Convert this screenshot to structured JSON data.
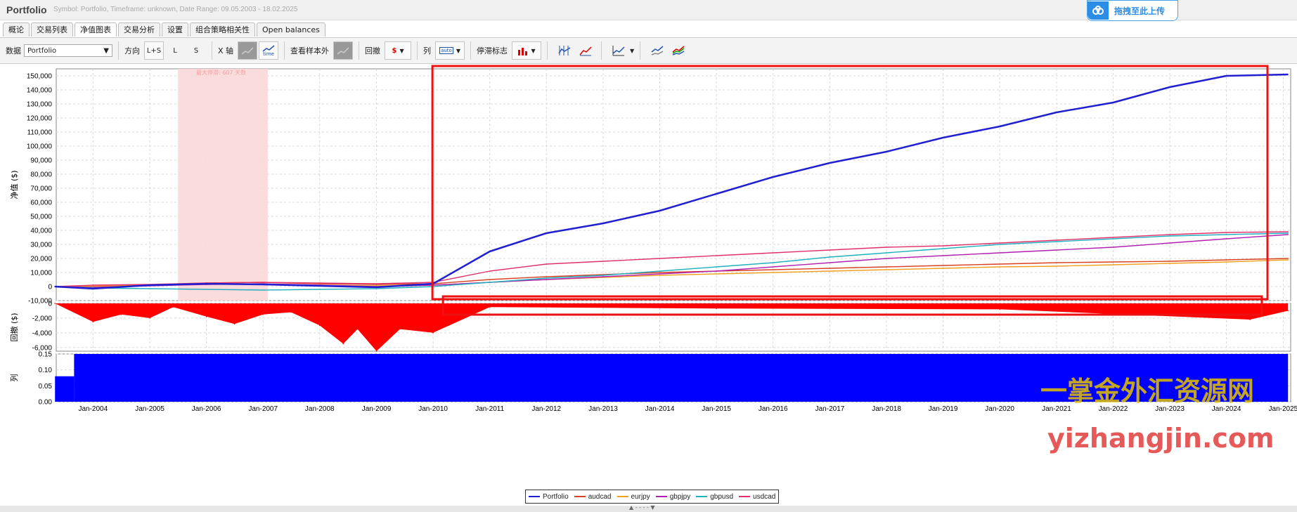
{
  "header": {
    "title": "Portfolio",
    "subtitle": "Symbol: Portfolio, Timeframe: unknown, Date Range: 09.05.2003 - 18.02.2025",
    "upload_label": "拖拽至此上传"
  },
  "tabs": [
    "概论",
    "交易列表",
    "净值图表",
    "交易分析",
    "设置",
    "组合策略相关性",
    "Open balances"
  ],
  "active_tab": 2,
  "toolbar": {
    "data_label": "数据",
    "data_value": "Portfolio",
    "direction_label": "方向",
    "direction_options": [
      "L+S",
      "L",
      "S"
    ],
    "x_axis_label": "X 轴",
    "time_label": "time",
    "oos_label": "查看样本外",
    "drawdown_label": "回撤",
    "dollar_icon_text": "$",
    "columns_label": "列",
    "auto_icon_text": "auto",
    "stagnation_label": "停滞标志"
  },
  "chart_data": [
    {
      "type": "line",
      "ylabel": "净值 ($)",
      "ylim": [
        -10000,
        155000
      ],
      "yticks": [
        "150,000",
        "140,000",
        "130,000",
        "120,000",
        "110,000",
        "100,000",
        "90,000",
        "80,000",
        "70,000",
        "60,000",
        "50,000",
        "40,000",
        "30,000",
        "20,000",
        "10,000",
        "0",
        "-10,000"
      ],
      "stagnation_annotation": "最大停滞: 607 天数",
      "stagnation_period": [
        "2005-07",
        "2007-02"
      ],
      "highlight_box_from": "2010-01",
      "x": [
        "2003-05",
        "2004-01",
        "2005-01",
        "2006-01",
        "2007-01",
        "2008-01",
        "2009-01",
        "2010-01",
        "2011-01",
        "2012-01",
        "2013-01",
        "2014-01",
        "2015-01",
        "2016-01",
        "2017-01",
        "2018-01",
        "2019-01",
        "2020-01",
        "2021-01",
        "2022-01",
        "2023-01",
        "2024-01",
        "2025-02"
      ],
      "series": [
        {
          "name": "Portfolio",
          "color": "#2020d0",
          "values": [
            0,
            -1500,
            1000,
            2000,
            1500,
            500,
            -500,
            2000,
            25000,
            38000,
            45000,
            54000,
            66000,
            78000,
            88000,
            96000,
            106000,
            114000,
            124000,
            131000,
            142000,
            150000,
            151000
          ]
        },
        {
          "name": "audcad",
          "color": "#d84020",
          "values": [
            0,
            200,
            1000,
            2500,
            3000,
            2000,
            1500,
            2000,
            5000,
            7000,
            8500,
            10000,
            11000,
            12000,
            13000,
            14000,
            15000,
            16000,
            17000,
            17500,
            18000,
            19000,
            20000
          ]
        },
        {
          "name": "eurjpy",
          "color": "#f0a020",
          "values": [
            0,
            300,
            800,
            1500,
            1800,
            1000,
            500,
            1000,
            3000,
            5000,
            6500,
            8000,
            9000,
            10000,
            11000,
            12000,
            13000,
            14000,
            14500,
            15500,
            16500,
            17500,
            19000
          ]
        },
        {
          "name": "gbpjpy",
          "color": "#b020b0",
          "values": [
            0,
            -500,
            500,
            1500,
            2000,
            1000,
            0,
            1000,
            3000,
            5000,
            7000,
            9000,
            11000,
            14000,
            17000,
            20000,
            22000,
            24000,
            26000,
            28000,
            31000,
            34000,
            37000
          ]
        },
        {
          "name": "gbpusd",
          "color": "#20b0c0",
          "values": [
            0,
            -1000,
            -1500,
            -2000,
            -2500,
            -2000,
            -1500,
            0,
            3000,
            6000,
            8000,
            11000,
            14000,
            17000,
            21000,
            24000,
            27000,
            30000,
            32000,
            34000,
            36000,
            37000,
            38000
          ]
        },
        {
          "name": "usdcad",
          "color": "#e0306a",
          "values": [
            0,
            1000,
            1500,
            2500,
            3000,
            2500,
            2000,
            3000,
            11000,
            16000,
            18000,
            20000,
            22000,
            24000,
            26000,
            28000,
            29000,
            31000,
            33000,
            35000,
            37000,
            38500,
            39000
          ]
        }
      ]
    },
    {
      "type": "area",
      "ylabel": "回撤 ($)",
      "ylim": [
        -6500,
        0
      ],
      "yticks": [
        "0",
        "-2,000",
        "-4,000",
        "-6,000"
      ],
      "color": "#ff0000",
      "x": [
        "2003-05",
        "2004-01",
        "2004-07",
        "2005-01",
        "2005-06",
        "2006-01",
        "2006-07",
        "2007-01",
        "2007-07",
        "2008-01",
        "2008-06",
        "2008-09",
        "2009-01",
        "2009-06",
        "2010-01",
        "2011-01",
        "2015-01",
        "2020-01",
        "2024-06",
        "2025-02"
      ],
      "values": [
        0,
        -2500,
        -1500,
        -2000,
        -500,
        -1800,
        -2800,
        -1500,
        -1200,
        -3000,
        -5500,
        -3500,
        -6500,
        -3500,
        -4000,
        -500,
        -700,
        -800,
        -2200,
        -1000
      ]
    },
    {
      "type": "bar",
      "ylabel": "列",
      "ylim": [
        0,
        0.15
      ],
      "yticks": [
        "0.15",
        "0.10",
        "0.05",
        "0.00"
      ],
      "color": "#0000ff",
      "segments": [
        {
          "from": "2003-05",
          "to": "2003-09",
          "value": 0.08
        },
        {
          "from": "2003-09",
          "to": "2025-02",
          "value": 0.15
        }
      ]
    }
  ],
  "x_axis_ticks": [
    "Jan-2004",
    "Jan-2005",
    "Jan-2006",
    "Jan-2007",
    "Jan-2008",
    "Jan-2009",
    "Jan-2010",
    "Jan-2011",
    "Jan-2012",
    "Jan-2013",
    "Jan-2014",
    "Jan-2015",
    "Jan-2016",
    "Jan-2017",
    "Jan-2018",
    "Jan-2019",
    "Jan-2020",
    "Jan-2021",
    "Jan-2022",
    "Jan-2023",
    "Jan-2024",
    "Jan-2025"
  ],
  "watermark": {
    "cn": "一掌金外汇资源网",
    "url": "yizhangjin.com"
  }
}
